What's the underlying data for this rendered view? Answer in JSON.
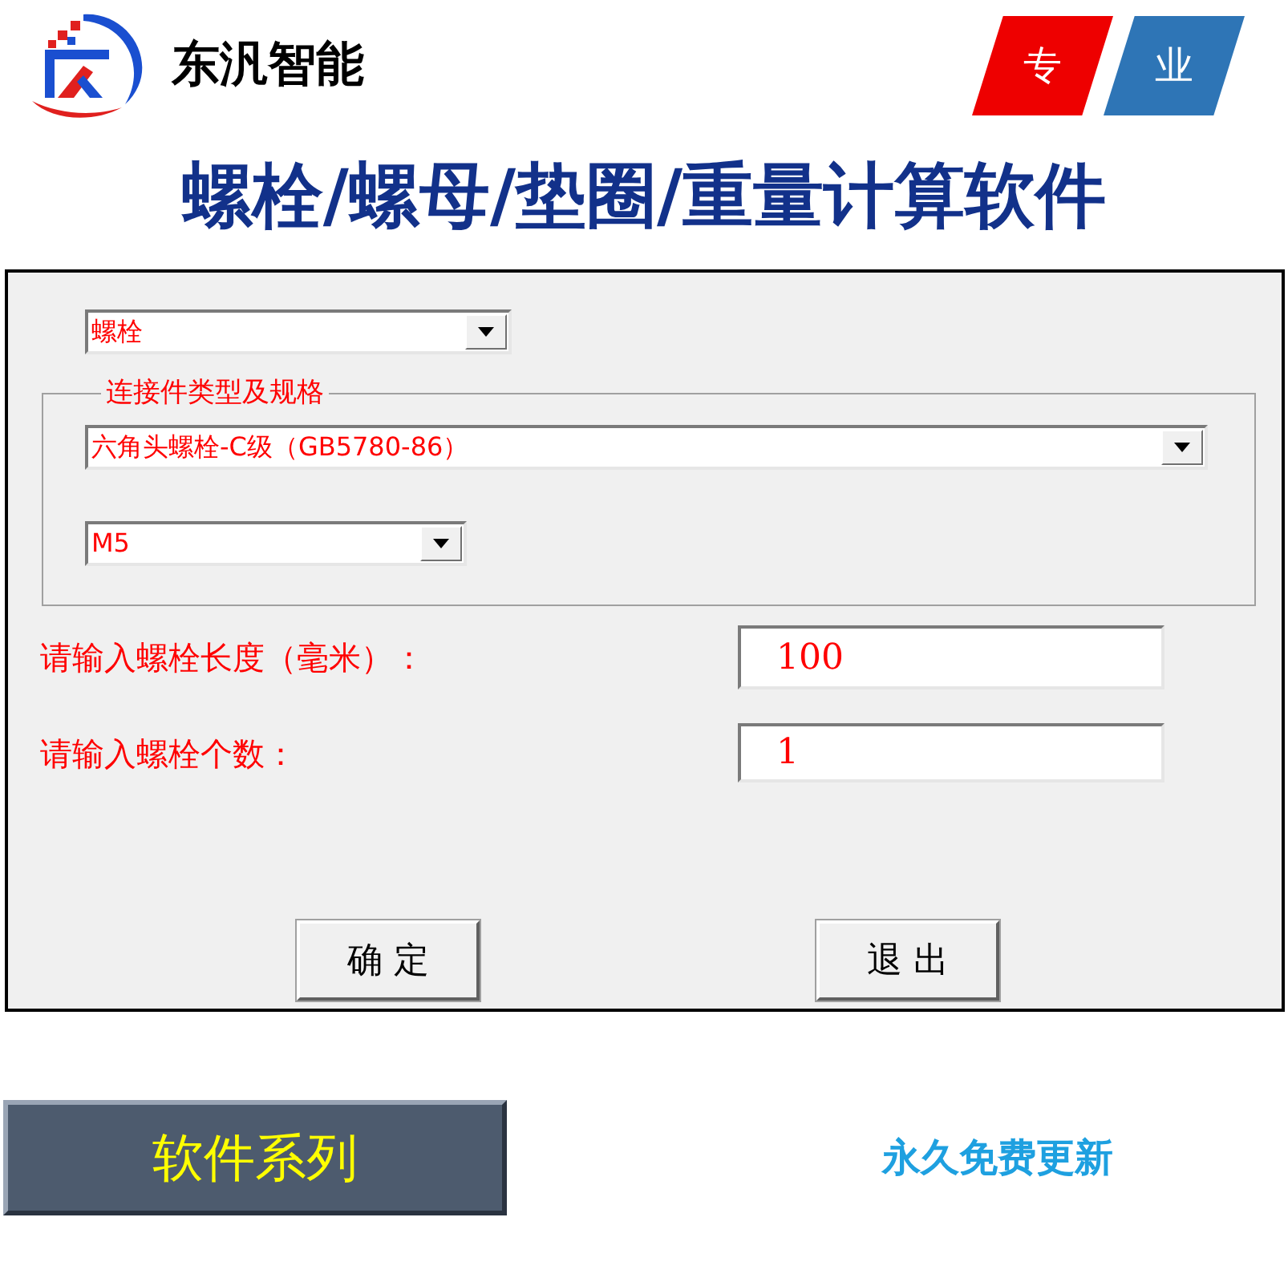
{
  "brand": {
    "name": "东汎智能"
  },
  "badges": [
    {
      "text": "专",
      "color": "#ee0000"
    },
    {
      "text": "业",
      "color": "#2e75b6"
    }
  ],
  "title": "螺栓/螺母/垫圈/重量计算软件",
  "window": {
    "type_select": {
      "value": "螺栓"
    },
    "group": {
      "label": "连接件类型及规格",
      "standard_select": {
        "value": "六角头螺栓-C级（GB5780-86）"
      },
      "size_select": {
        "value": "M5"
      }
    },
    "fields": [
      {
        "label": "请输入螺栓长度（毫米）：",
        "value": "100"
      },
      {
        "label": "请输入螺栓个数：",
        "value": "1"
      }
    ],
    "buttons": [
      "确 定",
      "退 出"
    ]
  },
  "footer": {
    "series_button": "软件系列",
    "slogan": "永久免费更新"
  }
}
